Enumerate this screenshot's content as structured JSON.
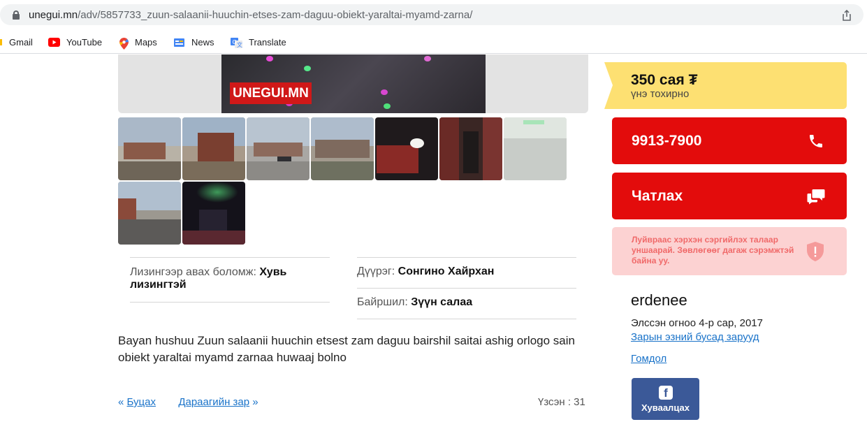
{
  "browser": {
    "url_host": "unegui.mn",
    "url_path": "/adv/5857733_zuun-salaanii-huuchin-etses-zam-daguu-obiekt-yaraltai-myamd-zarna/",
    "bookmarks": [
      {
        "label": "Gmail",
        "icon": "gmail-icon"
      },
      {
        "label": "YouTube",
        "icon": "youtube-icon"
      },
      {
        "label": "Maps",
        "icon": "maps-icon"
      },
      {
        "label": "News",
        "icon": "news-icon"
      },
      {
        "label": "Translate",
        "icon": "translate-icon"
      }
    ]
  },
  "gallery": {
    "watermark": "UNEGUI.MN",
    "thumb_count": 9
  },
  "details": {
    "leasing_label": "Лизингээр авах боломж:",
    "leasing_value": "Хувь лизингтэй",
    "district_label": "Дүүрэг:",
    "district_value": "Сонгино Хайрхан",
    "location_label": "Байршил:",
    "location_value": "Зүүн салаа"
  },
  "description": "Bayan hushuu Zuun salaanii huuchin etsest zam daguu bairshil saitai ashig orlogo sain obiekt yaraltai myamd zarnaa huwaaj bolno",
  "nav": {
    "back_prefix": "«",
    "back_label": "Буцах",
    "next_label": "Дараагийн зар",
    "next_suffix": "»",
    "views": "Үзсэн : 31"
  },
  "sidebar": {
    "price": "350 сая ₮",
    "price_note": "үнэ тохирно",
    "phone": "9913-7900",
    "chat_label": "Чатлах",
    "warning": "Луйврааc хэрхэн сэргийлэх талаар уншаарай. Зөвлөгөөг дагаж сэрэмжтэй байна уу.",
    "seller_name": "erdenee",
    "joined": "Элссэн огноо 4-р сар, 2017",
    "other_ads_link": "Зарын эзний бусад зарууд",
    "report_link": "Гомдол",
    "share_label": "Хуваалцах"
  },
  "colors": {
    "price_bg": "#fde072",
    "button_red": "#e30c0c",
    "warning_bg": "#fcd2d2",
    "link_blue": "#1a73c9",
    "facebook_blue": "#3b5998"
  }
}
